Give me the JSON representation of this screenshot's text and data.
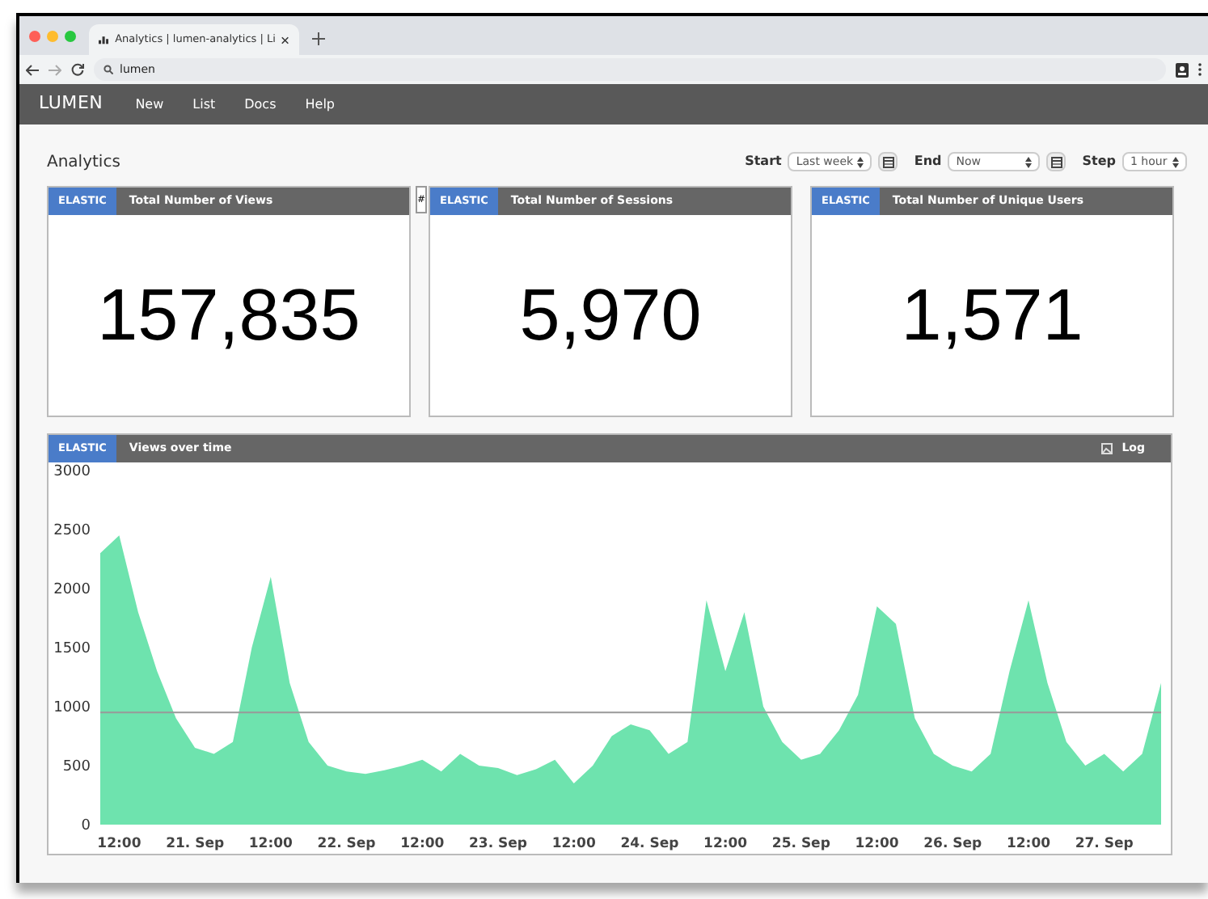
{
  "browser": {
    "tab_title": "Analytics | lumen-analytics | Li",
    "address": "lumen"
  },
  "navbar": {
    "brand": "LUMEN",
    "items": [
      {
        "label": "New"
      },
      {
        "label": "List"
      },
      {
        "label": "Docs"
      },
      {
        "label": "Help"
      }
    ]
  },
  "page_title": "Analytics",
  "controls": {
    "start": {
      "label": "Start",
      "value": "Last week"
    },
    "end": {
      "label": "End",
      "value": "Now"
    },
    "step": {
      "label": "Step",
      "value": "1 hour"
    }
  },
  "cards": [
    {
      "badge": "ELASTIC",
      "title": "Total Number of Views",
      "value": "157,835"
    },
    {
      "badge": "ELASTIC",
      "title": "Total Number of Sessions",
      "value": "5,970"
    },
    {
      "badge": "ELASTIC",
      "title": "Total Number of Unique Users",
      "value": "1,571"
    }
  ],
  "card_marker": "#",
  "chart_panel": {
    "badge": "ELASTIC",
    "title": "Views over time",
    "log_label": "Log",
    "chart_data": {
      "type": "area",
      "categories": [
        null,
        "12:00",
        null,
        null,
        null,
        "21. Sep",
        null,
        null,
        null,
        "12:00",
        null,
        null,
        null,
        "22. Sep",
        null,
        null,
        null,
        "12:00",
        null,
        null,
        null,
        "23. Sep",
        null,
        null,
        null,
        "12:00",
        null,
        null,
        null,
        "24. Sep",
        null,
        null,
        null,
        "12:00",
        null,
        null,
        null,
        "25. Sep",
        null,
        null,
        null,
        "12:00",
        null,
        null,
        null,
        "26. Sep",
        null,
        null,
        null,
        "12:00",
        null,
        null,
        null,
        "27. Sep",
        null,
        null,
        null
      ],
      "series": [
        {
          "color": "#6ee3ae",
          "values": [
            2300,
            2450,
            1800,
            1300,
            900,
            650,
            600,
            700,
            1500,
            2100,
            1200,
            700,
            500,
            450,
            430,
            460,
            500,
            550,
            450,
            600,
            500,
            480,
            420,
            470,
            550,
            350,
            500,
            750,
            850,
            800,
            600,
            700,
            1900,
            1300,
            1800,
            1000,
            700,
            550,
            600,
            800,
            1100,
            1850,
            1700,
            900,
            600,
            500,
            450,
            600,
            1300,
            1900,
            1200,
            700,
            500,
            600,
            450,
            600,
            1200
          ]
        },
        {
          "type": "line",
          "color": "#999999",
          "values": [
            950,
            950,
            950,
            950,
            950,
            950,
            950,
            950,
            950,
            950,
            950,
            950,
            950,
            950,
            950,
            950,
            950,
            950,
            950,
            950,
            950,
            950,
            950,
            950,
            950,
            950,
            950,
            950,
            950,
            950,
            950,
            950,
            950,
            950,
            950,
            950,
            950,
            950,
            950,
            950,
            950,
            950,
            950,
            950,
            950,
            950,
            950,
            950,
            950,
            950,
            950,
            950,
            950,
            950,
            950,
            950,
            950
          ]
        }
      ],
      "ylim": [
        0,
        3000
      ],
      "yticks": [
        0,
        500,
        1000,
        1500,
        2000,
        2500,
        3000
      ]
    }
  }
}
